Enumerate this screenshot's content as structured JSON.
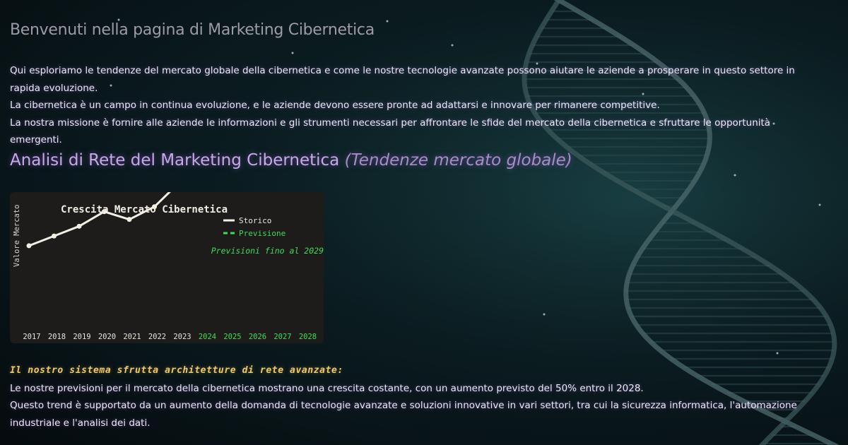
{
  "header": {
    "title": "Benvenuti nella pagina di Marketing Cibernetica"
  },
  "intro": {
    "paragraphs": [
      "Qui esploriamo le tendenze del mercato globale della cibernetica e come le nostre tecnologie avanzate possono aiutare le aziende a prosperare in questo settore in rapida evoluzione.",
      "La cibernetica è un campo in continua evoluzione, e le aziende devono essere pronte ad adattarsi e innovare per rimanere competitive.",
      "La nostra missione è fornire alle aziende le informazioni e gli strumenti necessari per affrontare le sfide del mercato della cibernetica e sfruttare le opportunità emergenti."
    ]
  },
  "section": {
    "title": "Analisi di Rete del Marketing Cibernetica",
    "subtitle": "(Tendenze mercato globale)"
  },
  "chart_data": {
    "type": "line",
    "title": "Crescita Mercato Cibernetica",
    "xlabel": "",
    "ylabel": "Valore Mercato",
    "categories": [
      "2017",
      "2018",
      "2019",
      "2020",
      "2021",
      "2022",
      "2023",
      "2024",
      "2025",
      "2026",
      "2027",
      "2028"
    ],
    "series": [
      {
        "name": "Storico",
        "values": [
          100,
          110,
          120,
          135,
          127,
          140,
          165,
          null,
          null,
          null,
          null,
          null
        ],
        "color": "#f3efe4"
      },
      {
        "name": "Previsione",
        "values": [
          null,
          null,
          null,
          null,
          null,
          null,
          null,
          null,
          null,
          null,
          null,
          null
        ],
        "color": "#3cdc5a"
      }
    ],
    "forecast_categories_color": "#3cdc5a",
    "annotation": "Previsioni fino al 2029",
    "ylim": [
      0,
      155
    ],
    "legend_position": "upper-right",
    "grid": false
  },
  "bottom": {
    "highlight": "Il nostro sistema sfrutta architetture di rete avanzate:",
    "paragraphs": [
      "Le nostre previsioni per il mercato della cibernetica mostrano una crescita costante, con un aumento previsto del 50% entro il 2028.",
      "Questo trend è supportato da un aumento della domanda di tecnologie avanzate e soluzioni innovative in vari settori, tra cui la sicurezza informatica, l'automazione industriale e l'analisi dei dati."
    ]
  }
}
